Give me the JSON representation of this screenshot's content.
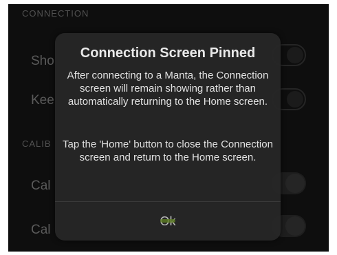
{
  "sections": {
    "connection_header": "CONNECTION",
    "calibration_header": "CALIB"
  },
  "rows": {
    "show": "Sho",
    "keep": "Kee",
    "cal1": "Cal",
    "cal2": "Cal"
  },
  "alert": {
    "title": "Connection Screen Pinned",
    "message_1": "After connecting to a Manta, the Connection screen will remain showing rather than automatically returning to the Home screen.",
    "message_2": "Tap the 'Home' button to close the Connection screen and return to the Home screen.",
    "ok_label": "Ok"
  },
  "colors": {
    "background": "#161616",
    "alert_bg": "#262626",
    "accent_green": "#5c7d22"
  }
}
